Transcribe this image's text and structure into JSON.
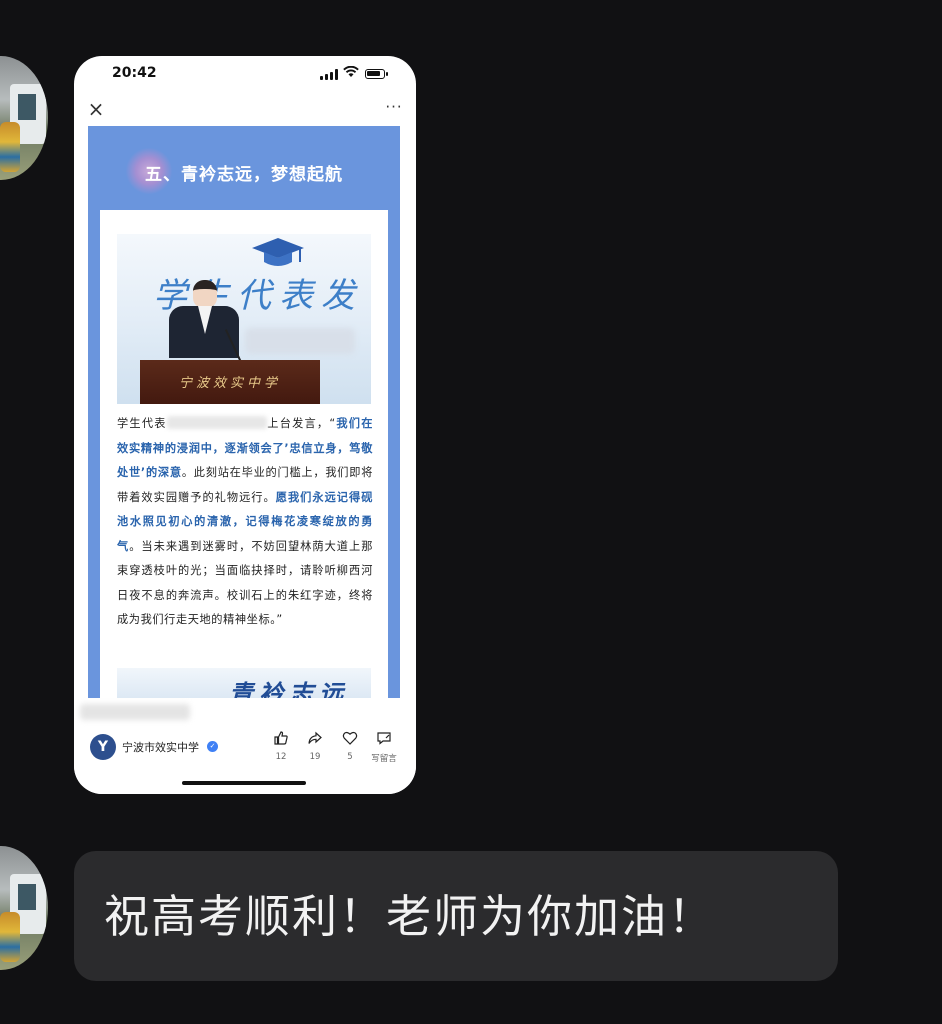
{
  "chat": {
    "messages": [
      {
        "type": "image",
        "sender": "contact"
      },
      {
        "type": "text",
        "sender": "contact",
        "text": "祝高考顺利！老师为你加油！"
      }
    ]
  },
  "screenshot": {
    "status_bar": {
      "time": "20:42"
    },
    "nav": {
      "close": "×",
      "more": "···"
    },
    "article": {
      "section_title": "五、青衿志远，梦想起航",
      "photo_banner_text": "学生代表发",
      "podium_text": "宁波效实中学",
      "paragraph": {
        "p1": "学生代表",
        "p2": "上台发言，“",
        "h1": "我们在效实精神的浸润中，逐渐领会了’忠信立身，笃敬处世’的深意",
        "p3": "。此刻站在毕业的门槛上，我们即将带着效实园赠予的礼物远行。",
        "h2": "愿我们永远记得砚池水照见初心的清澈，记得梅花凌寒绽放的勇气",
        "p4": "。当未来遇到迷雾时，不妨回望林荫大道上那束穿透枝叶的光；当面临抉择时，请聆听柳西河日夜不息的奔流声。校训石上的朱红字迹，终将成为我们行走天地的精神坐标。”"
      },
      "next_banner_text": "青衿志远"
    },
    "footer": {
      "account_name": "宁波市效实中学",
      "actions": [
        {
          "icon": "thumbs-up-icon",
          "glyph": "👍",
          "count": "12"
        },
        {
          "icon": "share-icon",
          "glyph": "↪",
          "count": "19"
        },
        {
          "icon": "heart-icon",
          "glyph": "♡",
          "count": "5"
        },
        {
          "icon": "comment-icon",
          "glyph": "✎",
          "count": "写留言"
        }
      ]
    }
  },
  "colors": {
    "background": "#111113",
    "bubble": "#2b2b2d",
    "article_blue": "#6a95dd",
    "highlight_text": "#2a64ad"
  }
}
